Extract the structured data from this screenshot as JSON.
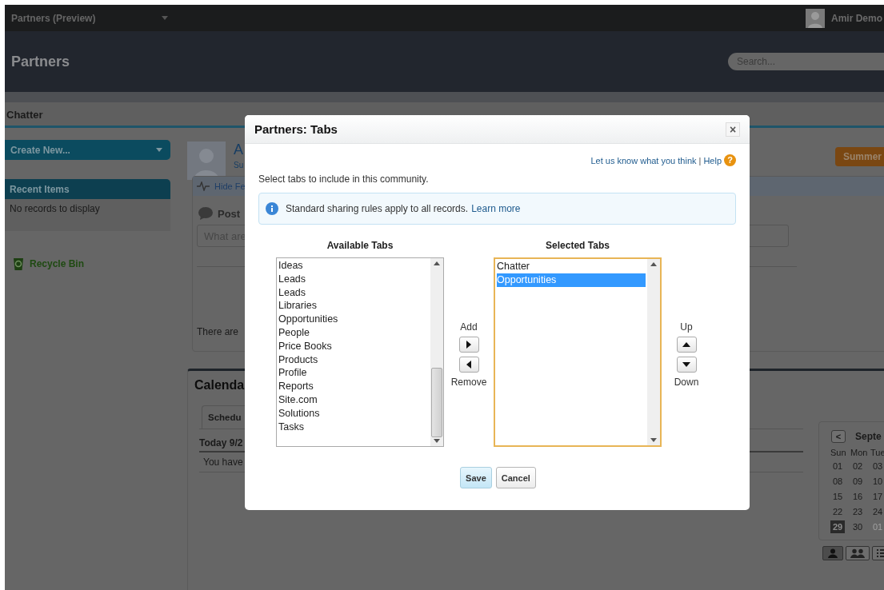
{
  "top_bar": {
    "app_menu": "Partners (Preview)",
    "user_name": "Amir Demo"
  },
  "header": {
    "title": "Partners",
    "search": {
      "placeholder": "Search..."
    }
  },
  "tabs": [
    {
      "label": "Chatter",
      "selected": true
    }
  ],
  "sidebar": {
    "create_button": "Create New...",
    "recent_title": "Recent Items",
    "recent_empty": "No records to display",
    "recycle_bin": "Recycle Bin"
  },
  "profile": {
    "name": "A",
    "subtitle": "Su",
    "badge": "Summer"
  },
  "feed": {
    "toggle": "Hide Fe",
    "post_label": "Post",
    "post_placeholder": "What are",
    "empty_text": "There are"
  },
  "calendar": {
    "title": "Calenda",
    "tab": "Schedu",
    "today": "Today 9/2",
    "message": "You have"
  },
  "mini_calendar": {
    "month": "Septe",
    "prev": "<",
    "weekdays": [
      "Sun",
      "Mon",
      "Tue"
    ],
    "weeks": [
      [
        {
          "day": "01",
          "selected": false,
          "other_month": false
        },
        {
          "day": "02",
          "selected": false,
          "other_month": false
        },
        {
          "day": "03",
          "selected": false,
          "other_month": false
        }
      ],
      [
        {
          "day": "08",
          "selected": false,
          "other_month": false
        },
        {
          "day": "09",
          "selected": false,
          "other_month": false
        },
        {
          "day": "10",
          "selected": false,
          "other_month": false
        }
      ],
      [
        {
          "day": "15",
          "selected": false,
          "other_month": false
        },
        {
          "day": "16",
          "selected": false,
          "other_month": false
        },
        {
          "day": "17",
          "selected": false,
          "other_month": false
        }
      ],
      [
        {
          "day": "22",
          "selected": false,
          "other_month": false
        },
        {
          "day": "23",
          "selected": false,
          "other_month": false
        },
        {
          "day": "24",
          "selected": false,
          "other_month": false
        }
      ],
      [
        {
          "day": "29",
          "selected": true,
          "other_month": false
        },
        {
          "day": "30",
          "selected": false,
          "other_month": false
        },
        {
          "day": "01",
          "selected": false,
          "other_month": true
        }
      ]
    ]
  },
  "dialog": {
    "title": "Partners: Tabs",
    "close": "×",
    "feedback_link": "Let us know what you think",
    "separator": "|",
    "help_link": "Help",
    "help_icon": "?",
    "instructions": "Select tabs to include in this community.",
    "info": {
      "text": "Standard sharing rules apply to all records.",
      "link": "Learn more"
    },
    "available": {
      "heading": "Available Tabs",
      "focused": false,
      "items": [
        {
          "label": "Ideas",
          "selected": false
        },
        {
          "label": "Leads",
          "selected": false
        },
        {
          "label": "Leads",
          "selected": false
        },
        {
          "label": "Libraries",
          "selected": false
        },
        {
          "label": "Opportunities",
          "selected": false
        },
        {
          "label": "People",
          "selected": false
        },
        {
          "label": "Price Books",
          "selected": false
        },
        {
          "label": "Products",
          "selected": false
        },
        {
          "label": "Profile",
          "selected": false
        },
        {
          "label": "Reports",
          "selected": false
        },
        {
          "label": "Site.com",
          "selected": false
        },
        {
          "label": "Solutions",
          "selected": false
        },
        {
          "label": "Tasks",
          "selected": false
        }
      ]
    },
    "chosen": {
      "heading": "Selected Tabs",
      "focused": true,
      "items": [
        {
          "label": "Chatter",
          "selected": false
        },
        {
          "label": "Opportunities",
          "selected": true
        }
      ]
    },
    "add_label": "Add",
    "remove_label": "Remove",
    "up_label": "Up",
    "down_label": "Down",
    "buttons": [
      {
        "label": "Save",
        "primary": true
      },
      {
        "label": "Cancel",
        "primary": false
      }
    ]
  }
}
